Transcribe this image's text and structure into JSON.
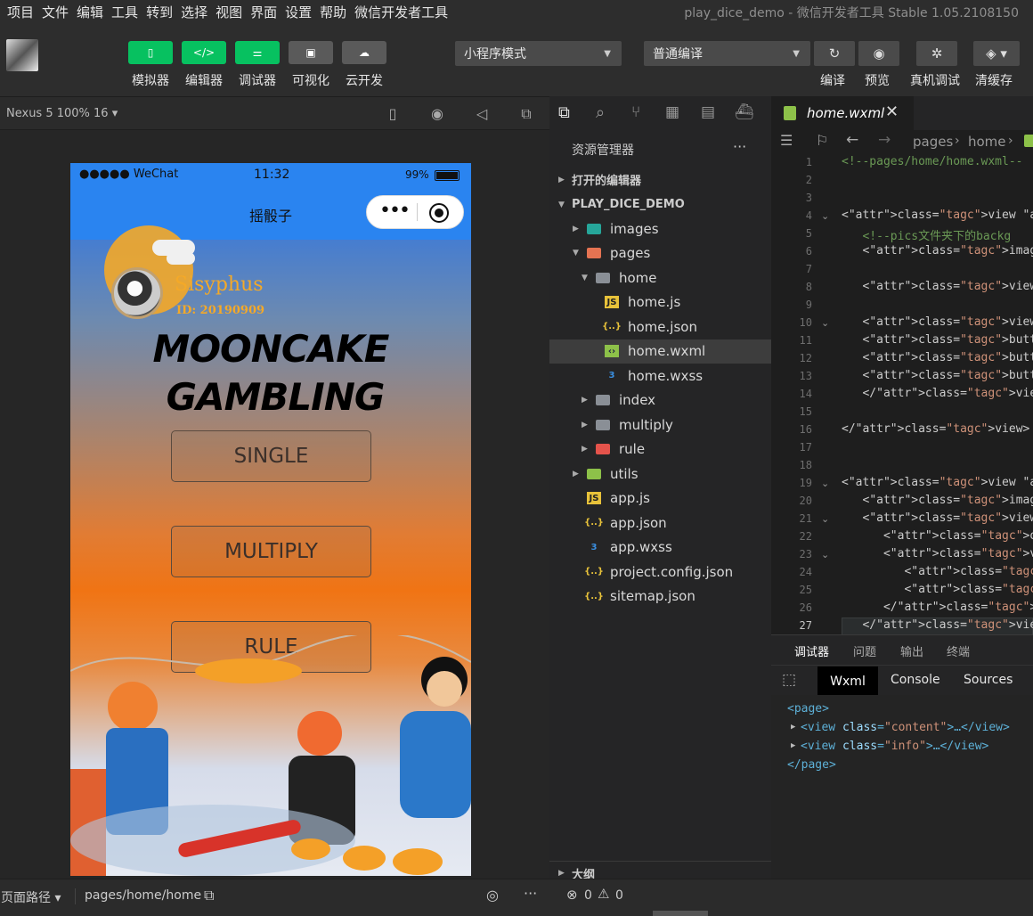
{
  "menu": [
    "项目",
    "文件",
    "编辑",
    "工具",
    "转到",
    "选择",
    "视图",
    "界面",
    "设置",
    "帮助",
    "微信开发者工具"
  ],
  "window_title": "play_dice_demo  -  微信开发者工具 Stable 1.05.2108150",
  "toolbar": {
    "left": [
      {
        "label": "模拟器",
        "icon": "phone-icon"
      },
      {
        "label": "编辑器",
        "icon": "code-icon"
      },
      {
        "label": "调试器",
        "icon": "sliders-icon"
      },
      {
        "label": "可视化",
        "icon": "layout-icon"
      },
      {
        "label": "云开发",
        "icon": "cloud-icon"
      }
    ],
    "mode_select": "小程序模式",
    "compile_select": "普通编译",
    "right": [
      {
        "label": "编译",
        "icon": "refresh-icon"
      },
      {
        "label": "预览",
        "icon": "eye-icon"
      },
      {
        "label": "真机调试",
        "icon": "bug-icon"
      },
      {
        "label": "清缓存",
        "icon": "layers-icon"
      }
    ]
  },
  "simulator": {
    "device": "Nexus 5 100% 16 ▾",
    "status": {
      "carrier": "●●●●● WeChat",
      "time": "11:32",
      "battery": "99%"
    },
    "nav_title": "摇骰子",
    "user": {
      "name": "Sisyphus",
      "id": "ID: 20190909"
    },
    "title_line1": "MOONCAKE",
    "title_line2": "GAMBLING",
    "buttons": [
      "SINGLE",
      "MULTIPLY",
      "RULE"
    ]
  },
  "explorer": {
    "title": "资源管理器",
    "more": "···",
    "open_editors": "打开的编辑器",
    "project": "PLAY_DICE_DEMO",
    "tree": [
      {
        "name": "images",
        "depth": 1,
        "kind": "folder",
        "expanded": false
      },
      {
        "name": "pages",
        "depth": 1,
        "kind": "folder",
        "expanded": true
      },
      {
        "name": "home",
        "depth": 2,
        "kind": "folder",
        "expanded": true
      },
      {
        "name": "home.js",
        "depth": 3,
        "kind": "js"
      },
      {
        "name": "home.json",
        "depth": 3,
        "kind": "json"
      },
      {
        "name": "home.wxml",
        "depth": 3,
        "kind": "wxml",
        "selected": true
      },
      {
        "name": "home.wxss",
        "depth": 3,
        "kind": "wxss"
      },
      {
        "name": "index",
        "depth": 2,
        "kind": "folder",
        "expanded": false
      },
      {
        "name": "multiply",
        "depth": 2,
        "kind": "folder",
        "expanded": false
      },
      {
        "name": "rule",
        "depth": 2,
        "kind": "folder",
        "expanded": false
      },
      {
        "name": "utils",
        "depth": 1,
        "kind": "folder",
        "expanded": false
      },
      {
        "name": "app.js",
        "depth": 1,
        "kind": "js"
      },
      {
        "name": "app.json",
        "depth": 1,
        "kind": "json"
      },
      {
        "name": "app.wxss",
        "depth": 1,
        "kind": "wxss"
      },
      {
        "name": "project.config.json",
        "depth": 1,
        "kind": "json"
      },
      {
        "name": "sitemap.json",
        "depth": 1,
        "kind": "json"
      }
    ],
    "outline": "大纲"
  },
  "editor": {
    "tab": "home.wxml",
    "breadcrumb": [
      "pages",
      "home"
    ],
    "lines": [
      {
        "n": "1",
        "code": "<!--pages/home/home.wxml--"
      },
      {
        "n": "2",
        "code": ""
      },
      {
        "n": "3",
        "code": ""
      },
      {
        "n": "4",
        "code": "<view class=\"content\">"
      },
      {
        "n": "5",
        "code": "   <!--pics文件夹下的backg"
      },
      {
        "n": "6",
        "code": "   <image class='backgrou"
      },
      {
        "n": "7",
        "code": ""
      },
      {
        "n": "8",
        "code": "   <view class = \"title\">"
      },
      {
        "n": "9",
        "code": ""
      },
      {
        "n": "10",
        "code": "   <view >"
      },
      {
        "n": "11",
        "code": "   <button  class = \"bott"
      },
      {
        "n": "12",
        "code": "   <button  class = \"bott"
      },
      {
        "n": "13",
        "code": "   <button  class = \"bott"
      },
      {
        "n": "14",
        "code": "   </view>"
      },
      {
        "n": "15",
        "code": ""
      },
      {
        "n": "16",
        "code": "</view>"
      },
      {
        "n": "17",
        "code": ""
      },
      {
        "n": "18",
        "code": ""
      },
      {
        "n": "19",
        "code": "<view class=\"info\">"
      },
      {
        "n": "20",
        "code": "   <image class=\"bg\" src="
      },
      {
        "n": "21",
        "code": "   <view class=\"top\">"
      },
      {
        "n": "22",
        "code": "      <open-data class=\""
      },
      {
        "n": "23",
        "code": "      <view class=\"cente"
      },
      {
        "n": "24",
        "code": "         <open-data cla"
      },
      {
        "n": "25",
        "code": "         <view class=\"i"
      },
      {
        "n": "26",
        "code": "      </view>"
      },
      {
        "n": "27",
        "code": "   </view>"
      }
    ]
  },
  "devtools": {
    "tabs": [
      "调试器",
      "问题",
      "输出",
      "终端"
    ],
    "subtabs": [
      "Wxml",
      "Console",
      "Sources"
    ],
    "wxml": [
      "<page>",
      "<view class=\"content\">…</view>",
      "<view class=\"info\">…</view>",
      "</page>"
    ]
  },
  "statusbar": {
    "path_label": "页面路径 ▾",
    "path": "pages/home/home",
    "errors": "0",
    "warnings": "0"
  }
}
